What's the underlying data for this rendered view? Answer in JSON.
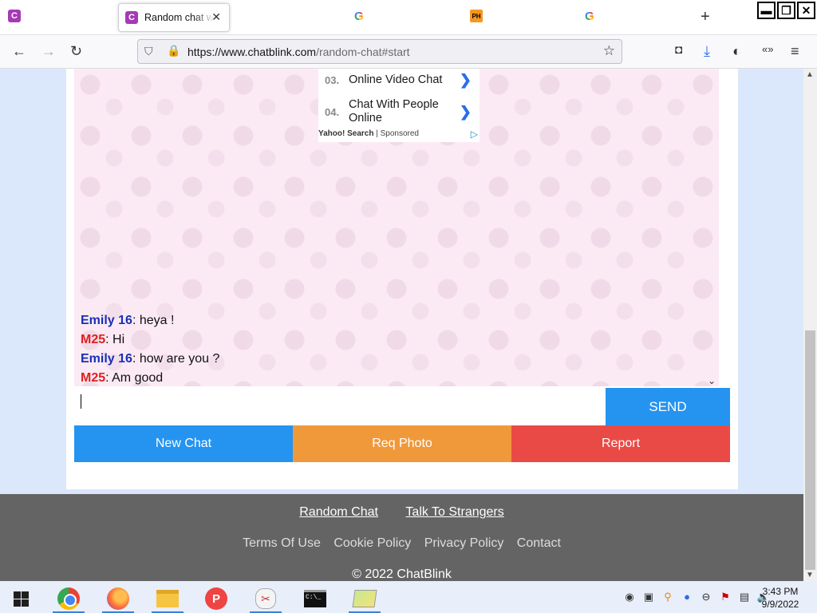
{
  "browser": {
    "active_tab_title": "Random chat with strangers",
    "tab_close": "✕",
    "new_tab": "+",
    "url_domain": "https://www.chatblink.com",
    "url_path": "/random-chat#start",
    "tabs": [
      {
        "favicon": "C"
      },
      {
        "favicon": "C",
        "active": true
      },
      {
        "favicon": "G"
      },
      {
        "favicon": "PH"
      },
      {
        "favicon": "G"
      }
    ]
  },
  "ad": {
    "items": [
      {
        "num": "03.",
        "text": "Online Video Chat"
      },
      {
        "num": "04.",
        "text": "Chat With People Online"
      }
    ],
    "provider": "Yahoo! Search",
    "sponsored": "Sponsored"
  },
  "messages": [
    {
      "who": "Emily 16",
      "type": "emily",
      "text": ": heya !"
    },
    {
      "who": "M25",
      "type": "m25",
      "text": ": Hi"
    },
    {
      "who": "Emily 16",
      "type": "emily",
      "text": ": how are you ?"
    },
    {
      "who": "M25",
      "type": "m25",
      "text": ": Am good"
    }
  ],
  "input": {
    "value": "",
    "placeholder": ""
  },
  "buttons": {
    "send": "SEND",
    "new_chat": "New Chat",
    "req_photo": "Req Photo",
    "report": "Report"
  },
  "footer": {
    "link_random_chat": "Random Chat",
    "link_talk_strangers": "Talk To Strangers",
    "terms": "Terms Of Use",
    "cookie": "Cookie Policy",
    "privacy": "Privacy Policy",
    "contact": "Contact",
    "copyright": "© 2022 ChatBlink"
  },
  "taskbar": {
    "time": "3:43 PM",
    "date": "9/9/2022",
    "cmd_text": "C:\\_"
  },
  "colors": {
    "send_blue": "#2594f0",
    "photo_orange": "#f0993b",
    "report_red": "#ea4a46",
    "emily_name": "#1a2fb5",
    "m25_name": "#e02020"
  }
}
